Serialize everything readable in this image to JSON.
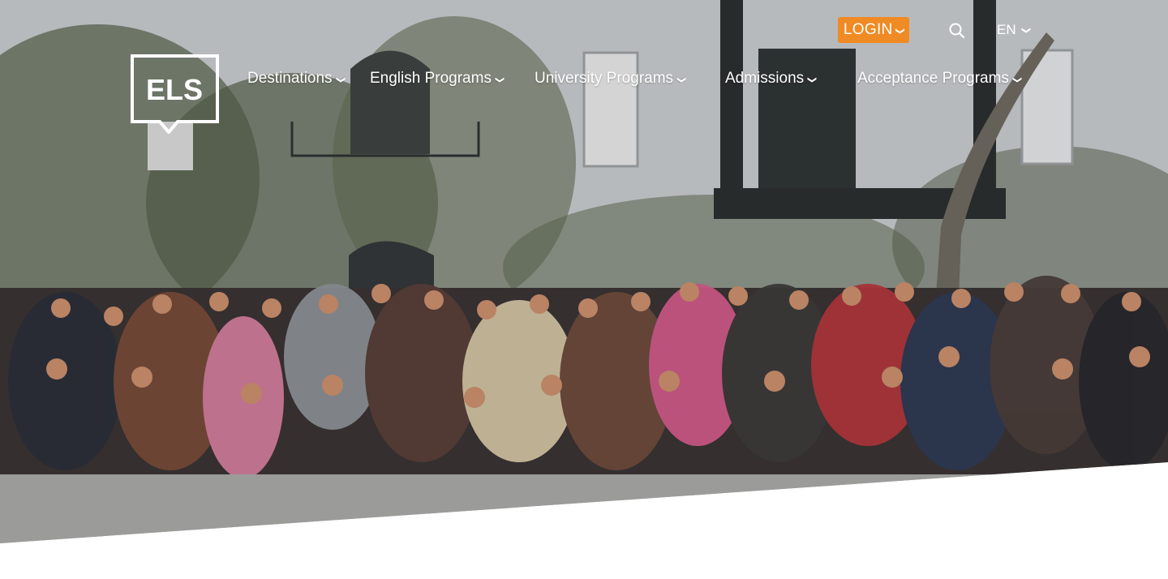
{
  "header": {
    "login_label": "LOGIN",
    "language": "EN",
    "logo_text": "ELS",
    "nav": [
      {
        "label": "Destinations"
      },
      {
        "label": "English Programs"
      },
      {
        "label": "University Programs"
      },
      {
        "label": "Admissions"
      },
      {
        "label": "Acceptance Programs"
      }
    ]
  },
  "icons": {
    "search": "search-icon",
    "chevron": "chevron-down-icon",
    "logo": "els-logo"
  },
  "colors": {
    "login_bg": "#f08a24",
    "nav_text": "#ffffff",
    "page_bg": "#ffffff"
  }
}
